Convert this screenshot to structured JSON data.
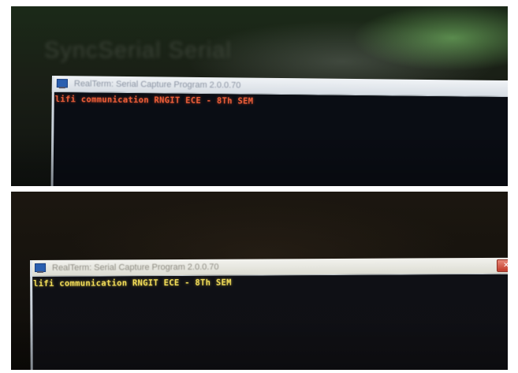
{
  "photos": [
    {
      "background_text": "SyncSerial Serial",
      "window": {
        "title": "RealTerm: Serial Capture Program 2.0.0.70",
        "terminal_line": "lifi communication RNGIT ECE - 8Th SEM",
        "text_color": "#f0603a"
      }
    },
    {
      "window": {
        "title": "RealTerm: Serial Capture Program 2.0.0.70",
        "terminal_line": "lifi communication RNGIT ECE - 8Th SEM",
        "text_color": "#f6e05a"
      }
    }
  ]
}
